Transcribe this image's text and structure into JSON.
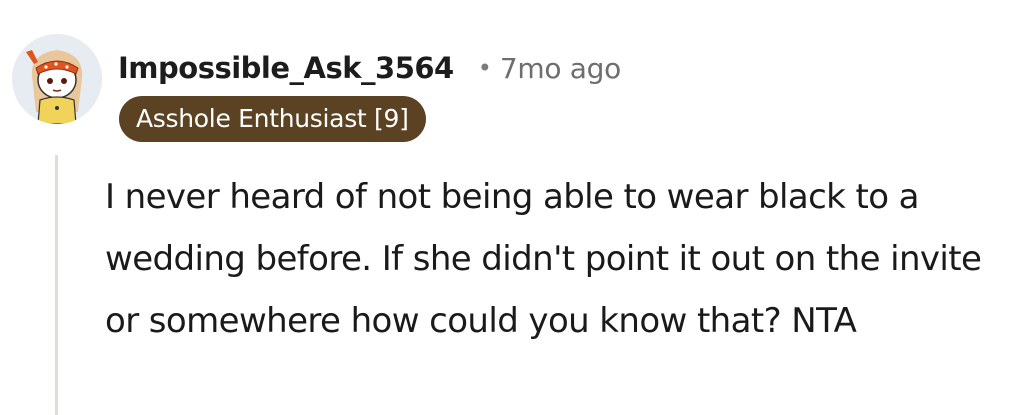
{
  "comment": {
    "author": "Impossible_Ask_3564",
    "separator": "•",
    "timestamp": "7mo ago",
    "flair": "Asshole Enthusiast [9]",
    "body": "I never heard of not being able to wear black to a wedding before. If she didn't point it out on the invite or somewhere how could you know that? NTA",
    "avatar_icon": "snoo-avatar-icon"
  },
  "colors": {
    "flair_background": "#5a4222",
    "flair_text": "#ffffff",
    "author_text": "#1c1c1c",
    "timestamp_text": "#6e6e6e",
    "thread_line": "#e3ddd6"
  }
}
